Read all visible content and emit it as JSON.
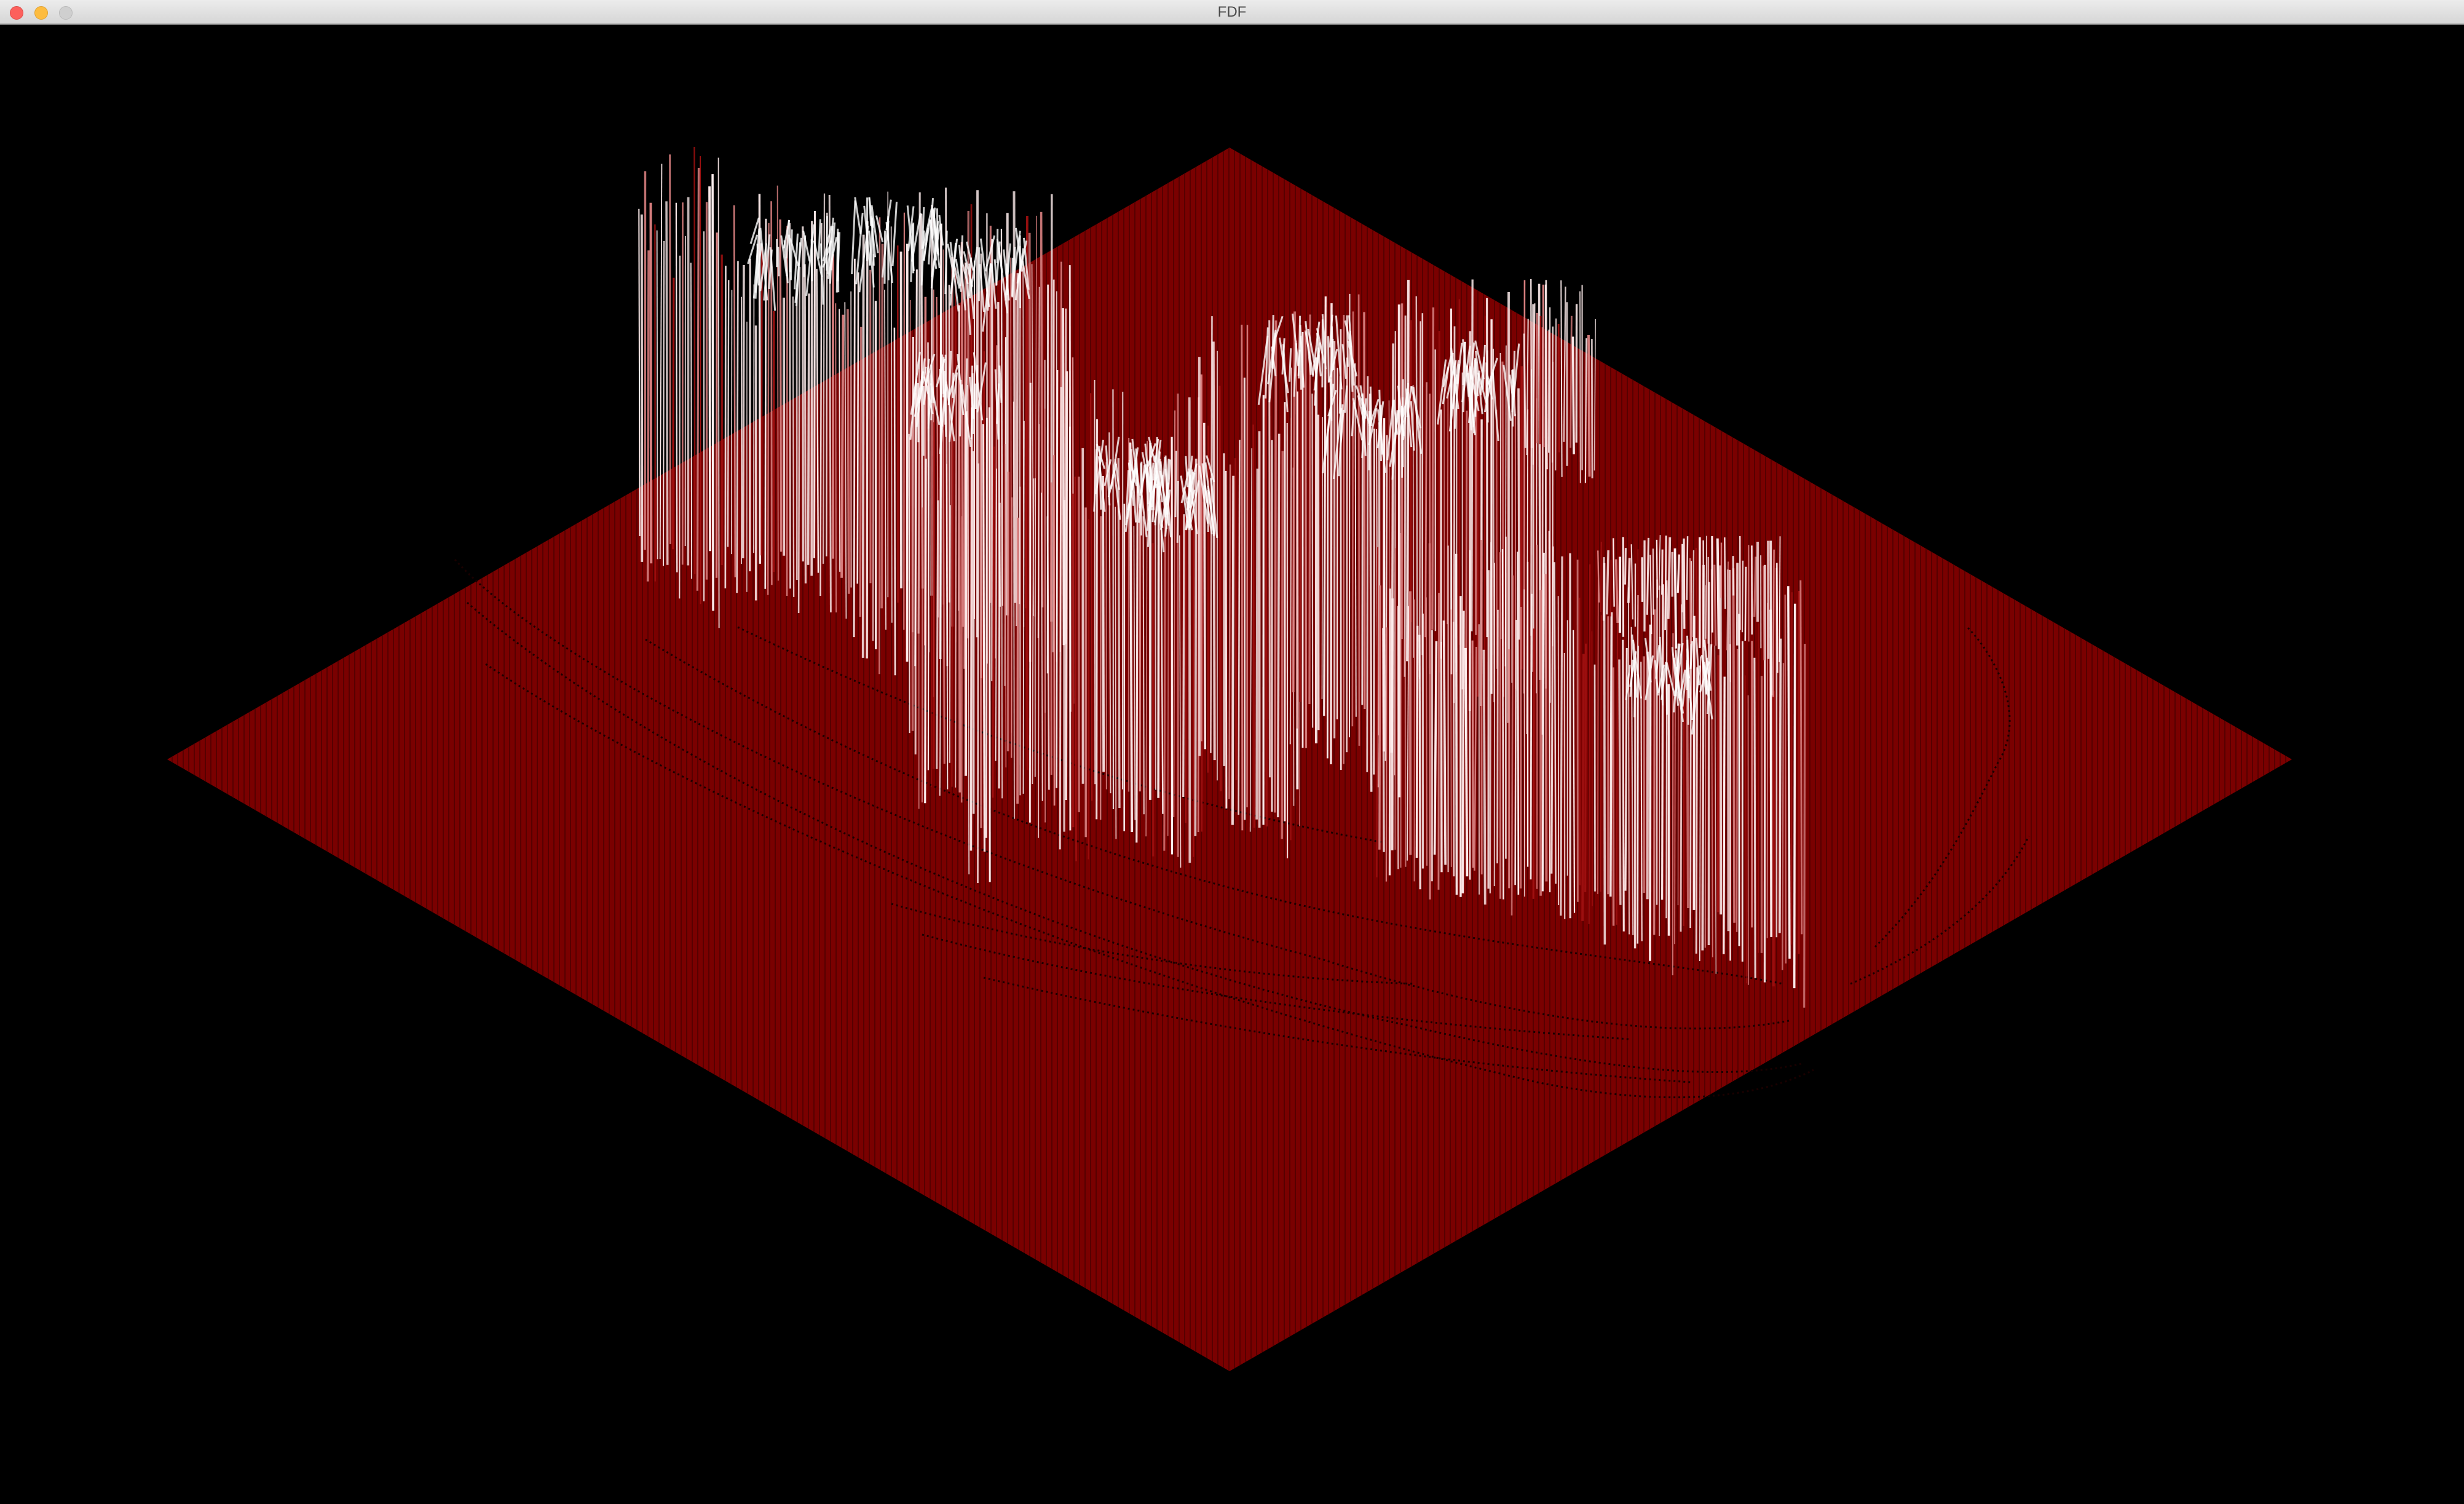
{
  "window": {
    "title": "FDF"
  },
  "render": {
    "background_color": "#000000",
    "base_color": "#7a0000",
    "base_line_color": "#3a0000",
    "peak_color": "#ffeeee",
    "mid_color": "#d98080"
  }
}
